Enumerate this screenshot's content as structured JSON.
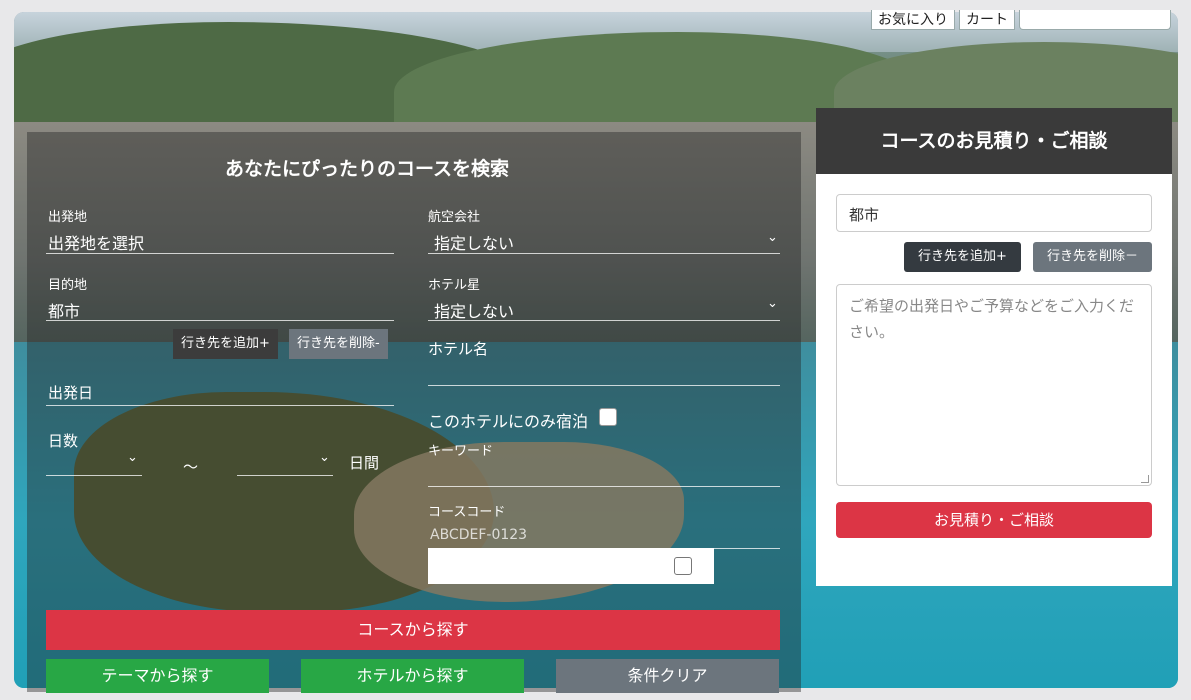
{
  "topbar": {
    "favorite_label": "お気に入り",
    "cart_label": "カート"
  },
  "search": {
    "title": "あなたにぴったりのコースを検索",
    "departure": {
      "label": "出発地",
      "value": "出発地を選択"
    },
    "airline": {
      "label": "航空会社",
      "value": "指定しない"
    },
    "destination": {
      "label": "目的地",
      "value": "都市"
    },
    "hotel_star": {
      "label": "ホテル星",
      "value": "指定しない"
    },
    "add_destination_label": "行き先を追加+",
    "remove_destination_label": "行き先を削除-",
    "hotel_name_label": "ホテル名",
    "departure_date_label": "出発日",
    "days_label": "日数",
    "days_tilde": "～",
    "days_unit": "日間",
    "hotel_only_label": "このホテルにのみ宿泊",
    "keyword_label": "キーワード",
    "course_code_label": "コースコード",
    "course_code_placeholder": "ABCDEF-0123",
    "search_course_label": "コースから探す",
    "search_theme_label": "テーマから探す",
    "search_hotel_label": "ホテルから探す",
    "clear_label": "条件クリア"
  },
  "consult": {
    "title": "コースのお見積り・ご相談",
    "city_value": "都市",
    "add_destination_label": "行き先を追加+",
    "remove_destination_label": "行き先を削除－",
    "textarea_placeholder": "ご希望の出発日やご予算などをご入力ください。",
    "submit_label": "お見積り・ご相談"
  },
  "colors": {
    "accent_red": "#dc3545",
    "green": "#28a745",
    "gray": "#6c757d",
    "dark": "#343a40"
  }
}
